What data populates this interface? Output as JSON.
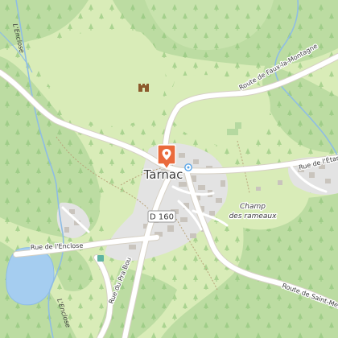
{
  "map": {
    "place_name": "Tarnac",
    "locality_line1": "Champ",
    "locality_line2": "des rameaux",
    "road_badge": "D 160",
    "streams": {
      "enclose_top": "L'Enclose",
      "enclose_bottom": "L'Enclose"
    },
    "roads": {
      "faux_la_montagne": "Route de Faux-la-Montagne",
      "etang": "Rue de l'Étang",
      "saint_merd": "Route de Saint-Merd",
      "enclose_rue": "Rue de l'Enclose",
      "pra_bou": "Rue du Pra Bou"
    },
    "marker_icon": "location-pin-icon",
    "castle_icon": "castle-icon",
    "colors": {
      "forest": "#bcdca2",
      "meadow": "#d9ecb8",
      "settlement": "#e3e3e3",
      "building": "#c9c4bd",
      "water": "#a5cdf0",
      "road": "#ffffff",
      "marker": "#ea6a3c"
    }
  }
}
